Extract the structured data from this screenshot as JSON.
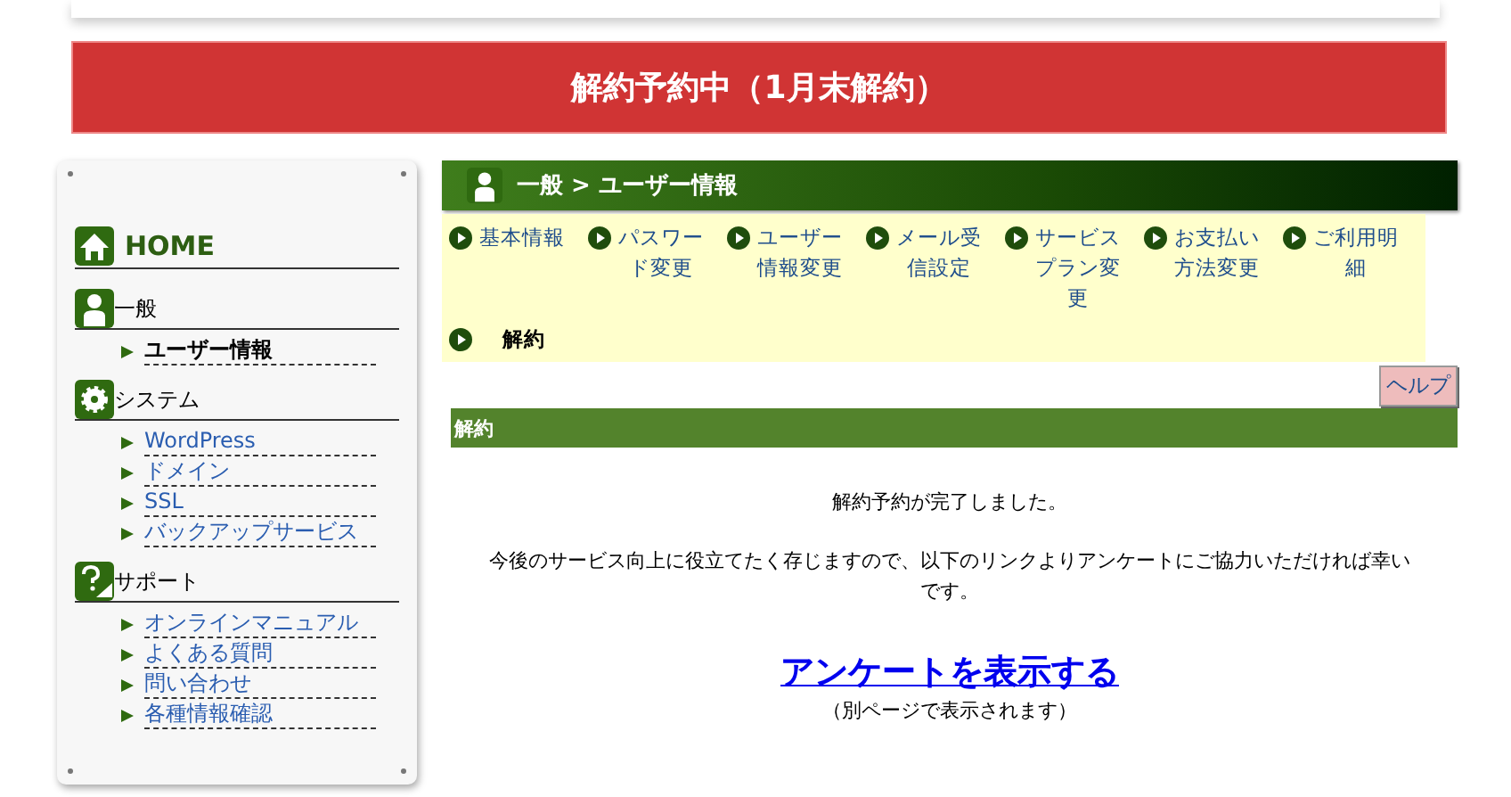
{
  "banner": {
    "title": "解約予約中（1月末解約）"
  },
  "sidebar": {
    "sections": [
      {
        "kind": "home",
        "title": "HOME"
      },
      {
        "kind": "user",
        "title": "一般",
        "items": [
          {
            "label": "ユーザー情報",
            "selected": true
          }
        ]
      },
      {
        "kind": "gear",
        "title": "システム",
        "items": [
          {
            "label": "WordPress",
            "selected": false
          },
          {
            "label": "ドメイン",
            "selected": false
          },
          {
            "label": "SSL",
            "selected": false
          },
          {
            "label": "バックアップサービス",
            "selected": false
          }
        ]
      },
      {
        "kind": "help",
        "title": "サポート",
        "items": [
          {
            "label": "オンラインマニュアル",
            "selected": false
          },
          {
            "label": "よくある質問",
            "selected": false
          },
          {
            "label": "問い合わせ",
            "selected": false
          },
          {
            "label": "各種情報確認",
            "selected": false
          }
        ]
      }
    ]
  },
  "header": {
    "title": "一般 > ユーザー情報"
  },
  "subnav": [
    {
      "label": "基本情報",
      "selected": false
    },
    {
      "label": "パスワード変更",
      "selected": false
    },
    {
      "label": "ユーザー情報変更",
      "selected": false
    },
    {
      "label": "メール受信設定",
      "selected": false
    },
    {
      "label": "サービスプラン変更",
      "selected": false
    },
    {
      "label": "お支払い方法変更",
      "selected": false
    },
    {
      "label": "ご利用明細",
      "selected": false
    },
    {
      "label": "解約",
      "selected": true
    }
  ],
  "help_button": "ヘルプ",
  "section": {
    "title": "解約",
    "message": "解約予約が完了しました。",
    "request": "今後のサービス向上に役立てたく存じますので、以下のリンクよりアンケートにご協力いただければ幸いです。",
    "link": "アンケートを表示する",
    "note": "（別ページで表示されます）"
  }
}
